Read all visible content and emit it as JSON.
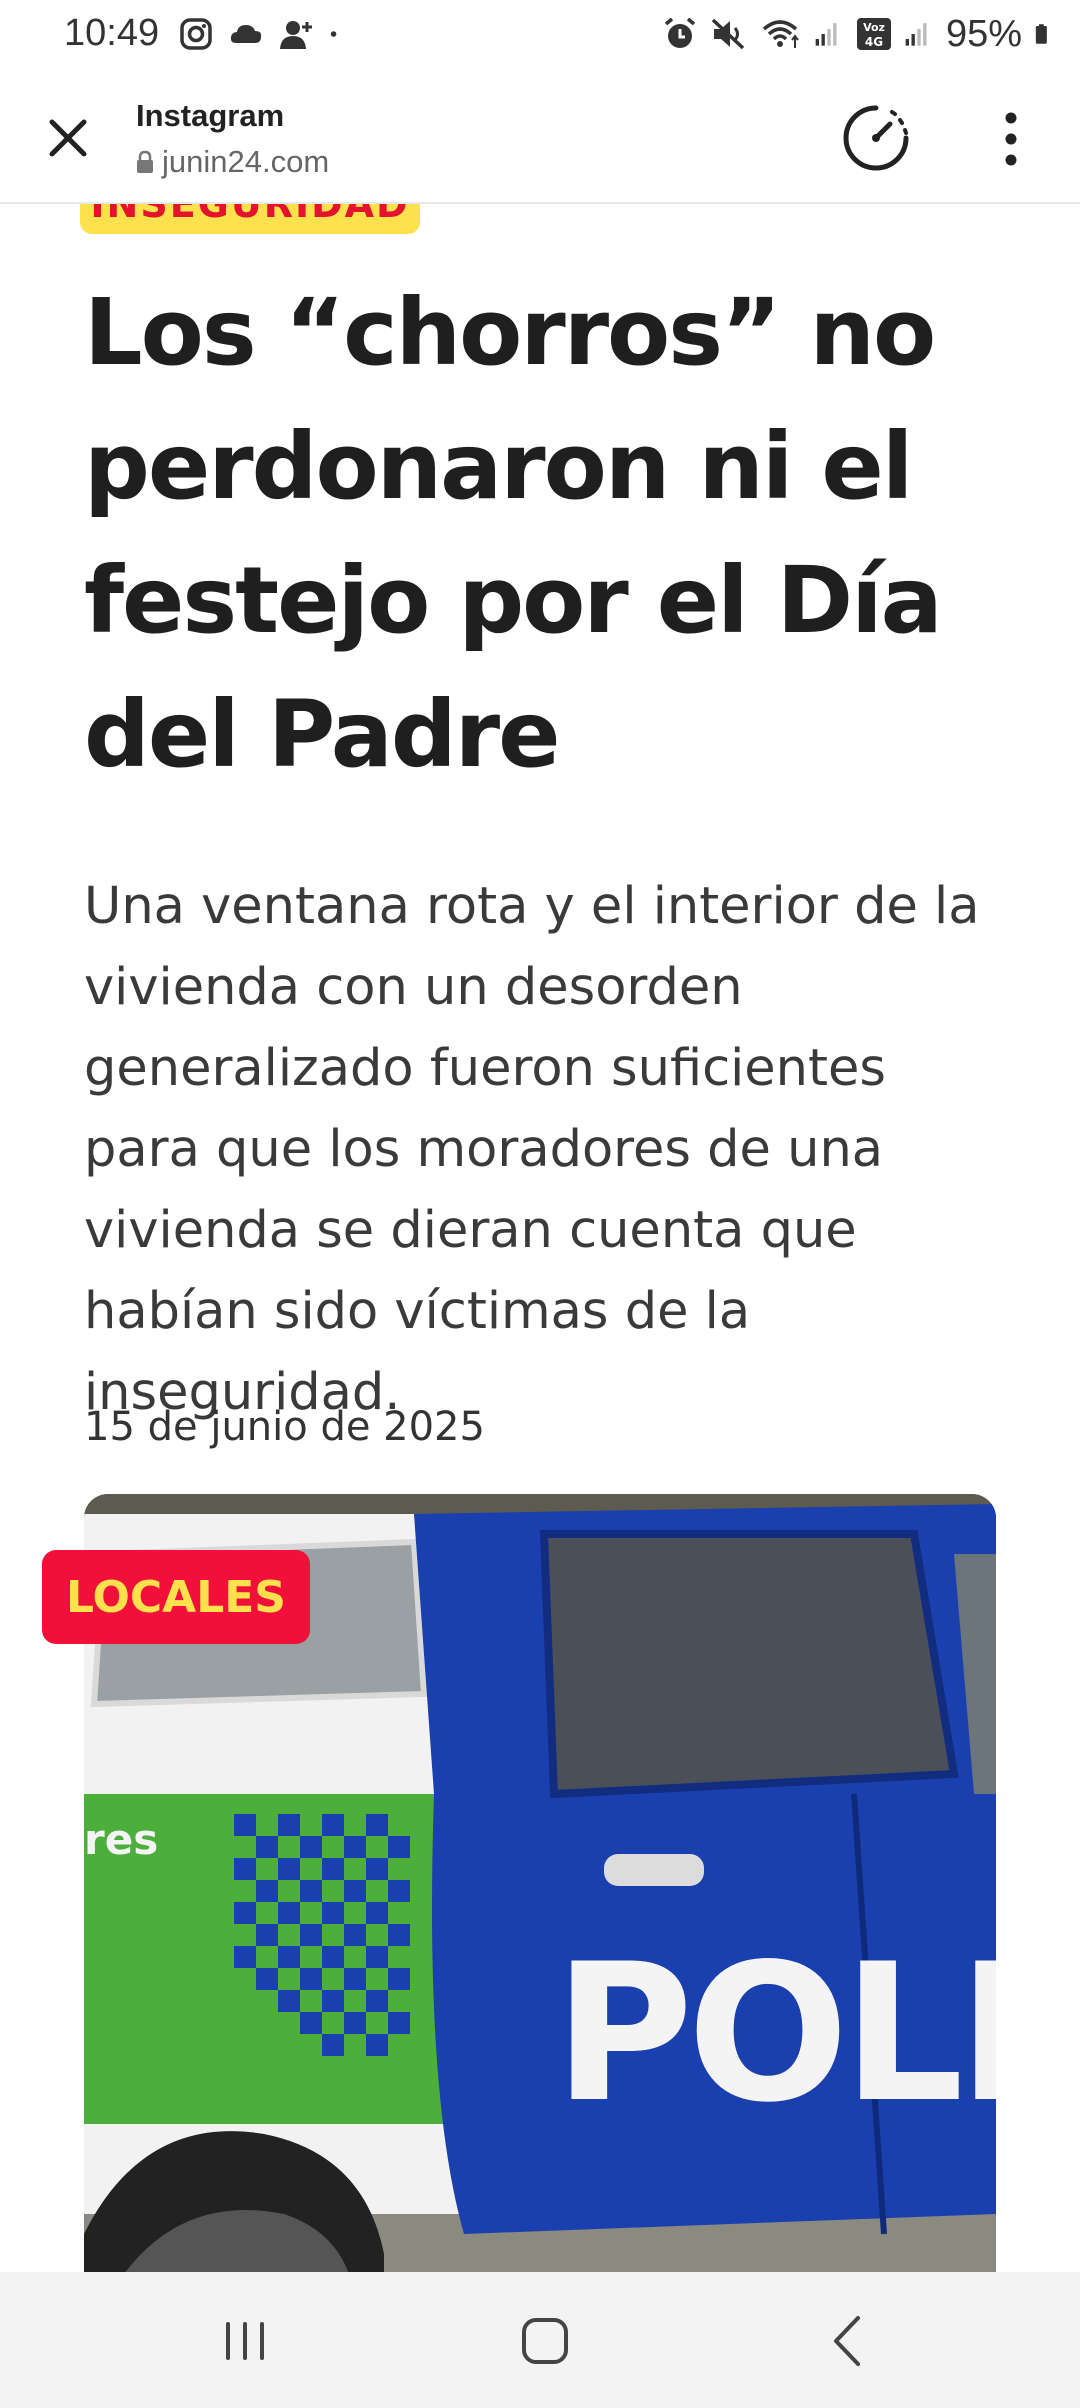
{
  "status_bar": {
    "time": "10:49",
    "battery": "95%",
    "icons": [
      "instagram-icon",
      "cloud-icon",
      "add-person-icon",
      "dot-icon",
      "alarm-icon",
      "mute-icon",
      "wifi-icon",
      "signal-icon",
      "volte-4g-icon",
      "signal-icon",
      "battery-icon"
    ]
  },
  "header": {
    "title": "Instagram",
    "url": "junin24.com",
    "icons": [
      "close-icon",
      "lock-icon",
      "speed-gauge-icon",
      "more-vert-icon"
    ]
  },
  "article": {
    "category": "INSEGURIDAD",
    "headline": "Los “chorros” no perdonaron ni el festejo por el Día del Padre",
    "summary": "Una ventana rota y el interior de la vivienda con un desorden generalizado fueron suficientes para que los moradores de una vivienda se dieran cuenta que habían sido víctimas de la inseguridad.",
    "date": "15 de junio de 2025",
    "image_badge": "LOCALES",
    "image_text": [
      "res",
      "POLIC"
    ]
  },
  "nav_bar": {
    "icons": [
      "recents-icon",
      "home-icon",
      "back-icon"
    ]
  },
  "colors": {
    "tag_yellow": "#ffe14d",
    "tag_red": "#e3122d",
    "badge_red": "#f0103a",
    "police_blue": "#1a3fae",
    "police_green": "#4caf3c"
  }
}
